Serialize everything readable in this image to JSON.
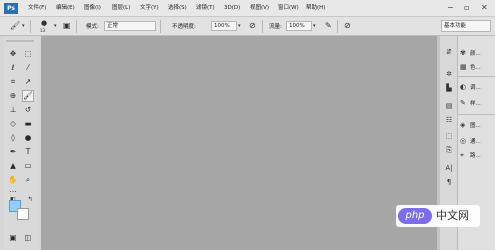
{
  "app": {
    "logo": "Ps"
  },
  "menu": {
    "items": [
      "文件(F)",
      "编辑(E)",
      "图像(I)",
      "图层(L)",
      "文字(Y)",
      "选择(S)",
      "滤镜(T)",
      "3D(D)",
      "视图(V)",
      "窗口(W)",
      "帮助(H)"
    ]
  },
  "window_controls": {
    "minimize": "−",
    "restore": "▫",
    "close": "✕"
  },
  "options": {
    "brush_size": "13",
    "mode_label": "模式:",
    "mode_value": "正常",
    "opacity_label": "不透明度:",
    "opacity_value": "100%",
    "flow_label": "流量:",
    "flow_value": "100%",
    "workspace": "基本功能"
  },
  "panels": {
    "items": [
      {
        "label": "颜...",
        "icon": "palette-icon"
      },
      {
        "label": "色...",
        "icon": "swatches-icon"
      },
      {
        "label": "调...",
        "icon": "adjustments-icon"
      },
      {
        "label": "样...",
        "icon": "styles-icon"
      },
      {
        "label": "图...",
        "icon": "layers-icon"
      },
      {
        "label": "通...",
        "icon": "channels-icon"
      },
      {
        "label": "路...",
        "icon": "paths-icon"
      }
    ]
  },
  "colors": {
    "foreground": "#8ecfff",
    "background": "#ffffff",
    "canvas": "#a6a6a6"
  },
  "watermark": {
    "logo": "php",
    "text": "中文网"
  }
}
